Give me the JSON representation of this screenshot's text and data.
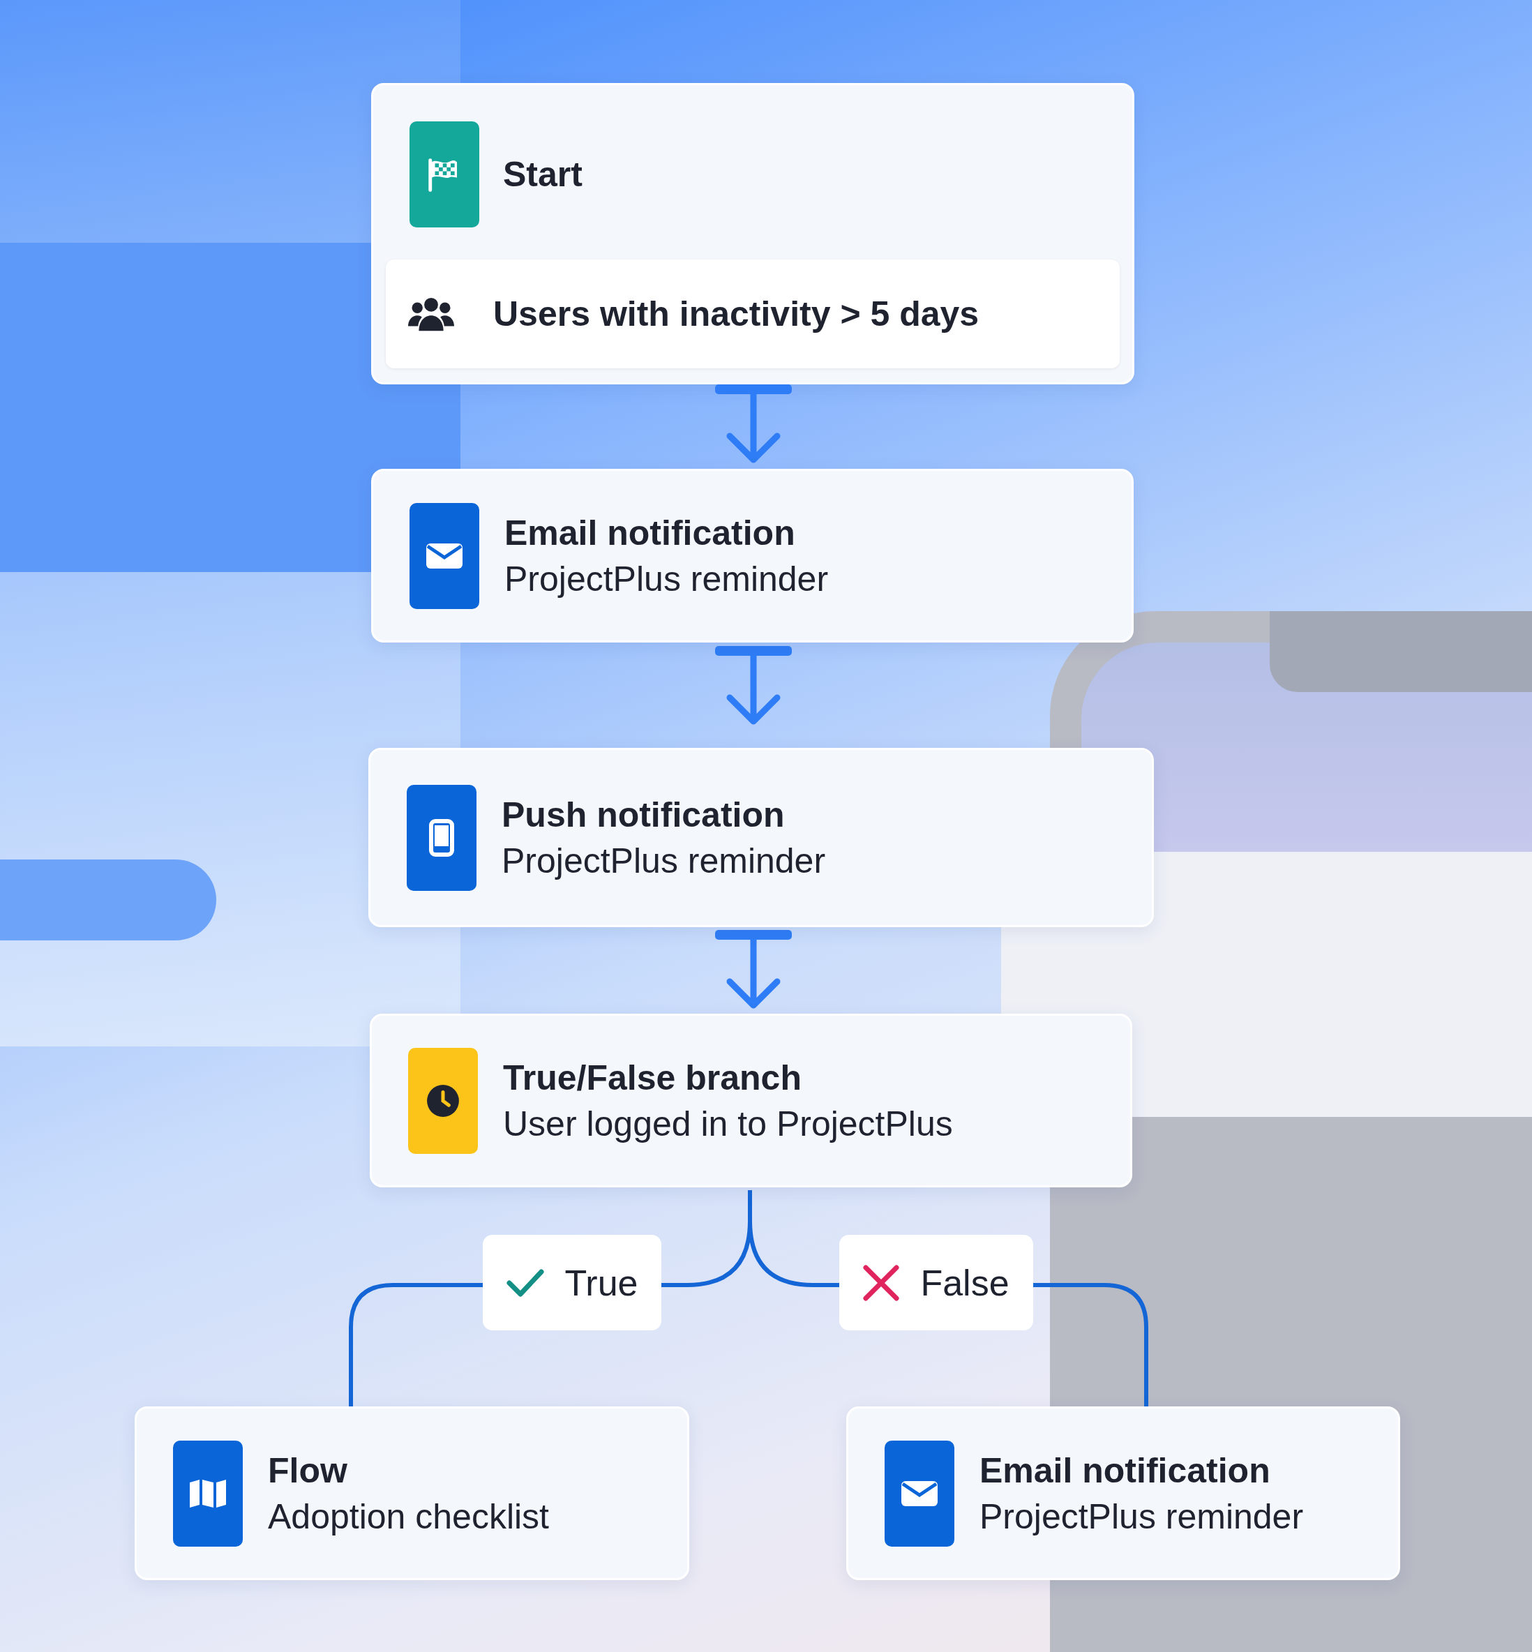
{
  "start": {
    "title": "Start",
    "condition": "Users with inactivity > 5 days"
  },
  "steps": [
    {
      "kind": "email",
      "title": "Email notification",
      "subtitle": "ProjectPlus reminder"
    },
    {
      "kind": "push",
      "title": "Push notification",
      "subtitle": "ProjectPlus reminder"
    },
    {
      "kind": "branch",
      "title": "True/False branch",
      "subtitle": "User logged in to ProjectPlus"
    }
  ],
  "branches": [
    {
      "kind": "true",
      "label": "True",
      "step": {
        "kind": "flow",
        "title": "Flow",
        "subtitle": "Adoption checklist"
      }
    },
    {
      "kind": "false",
      "label": "False",
      "step": {
        "kind": "email",
        "title": "Email notification",
        "subtitle": "ProjectPlus reminder"
      }
    }
  ]
}
